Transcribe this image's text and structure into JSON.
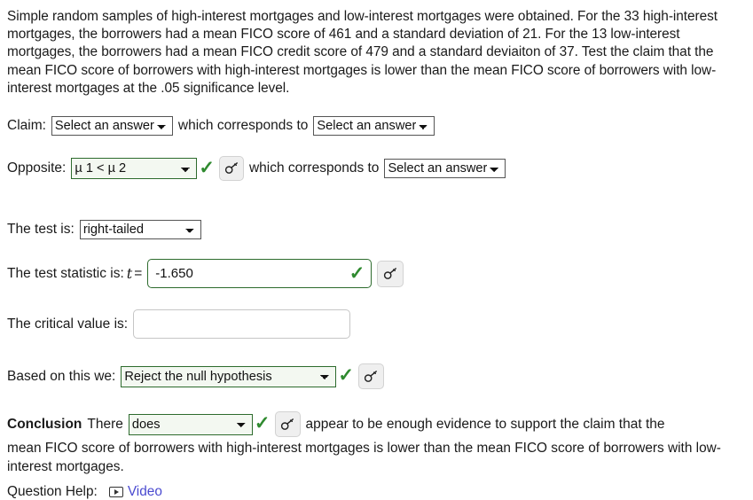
{
  "prompt": "Simple random samples of high-interest mortgages and low-interest mortgages were obtained. For the 33 high-interest mortgages, the borrowers had a mean FICO score of 461 and a standard deviation of 21. For the 13 low-interest mortgages, the borrowers had a mean FICO credit score of 479 and a standard deviaiton of 37. Test the claim that the mean FICO score of borrowers with high-interest mortgages is lower than the mean FICO score of borrowers with low-interest mortgages at the .05 significance level.",
  "claim": {
    "label": "Claim:",
    "hypothesis_value": "Select an answer",
    "connector": "which corresponds to",
    "correspondence_value": "Select an answer"
  },
  "opposite": {
    "label": "Opposite:",
    "hypothesis_value": "µ 1 < µ 2",
    "connector": "which corresponds to",
    "correspondence_value": "Select an answer",
    "key_icon": "key-icon",
    "check_icon": "check-icon"
  },
  "test_type": {
    "label": "The test is:",
    "value": "right-tailed"
  },
  "test_statistic": {
    "label": "The test statistic is:",
    "variable": "t",
    "equals": "=",
    "value": "-1.650",
    "key_icon": "key-icon",
    "check_icon": "check-icon"
  },
  "critical_value": {
    "label": "The critical value is:",
    "value": "",
    "placeholder": ""
  },
  "decision": {
    "label": "Based on this we:",
    "value": "Reject the null hypothesis",
    "key_icon": "key-icon",
    "check_icon": "check-icon"
  },
  "conclusion": {
    "heading": "Conclusion",
    "lead": "There",
    "value": "does",
    "after": "appear to be enough evidence to support the claim that the",
    "tail": "mean FICO score of borrowers with high-interest mortgages is lower than the mean FICO score of borrowers with low-interest mortgages.",
    "key_icon": "key-icon",
    "check_icon": "check-icon"
  },
  "question_help": {
    "label": "Question Help:",
    "video_label": "Video",
    "play_icon": "play-video-icon"
  },
  "colors": {
    "valid_green": "#2d6b2d",
    "check_green": "#2f8a2f",
    "link_blue": "#4a4ad0",
    "text": "#1a1a1a",
    "input_border": "#c6c6c6",
    "select_border": "#555555",
    "key_button_bg": "#efefef"
  }
}
